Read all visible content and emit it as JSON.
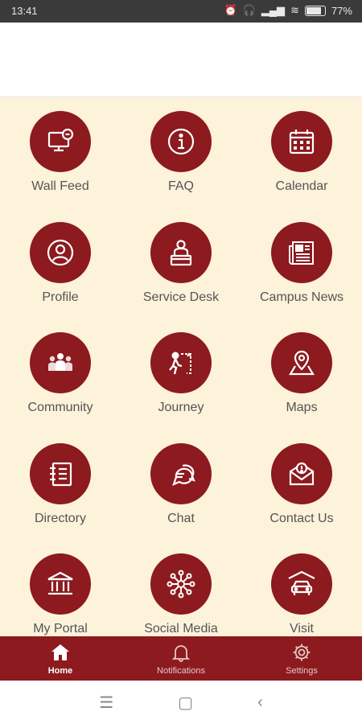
{
  "status": {
    "time": "13:41",
    "battery": "77%"
  },
  "tiles": [
    {
      "label": "Wall Feed",
      "icon": "monitor-chat-icon"
    },
    {
      "label": "FAQ",
      "icon": "info-icon"
    },
    {
      "label": "Calendar",
      "icon": "calendar-icon"
    },
    {
      "label": "Profile",
      "icon": "user-icon"
    },
    {
      "label": "Service Desk",
      "icon": "service-desk-icon"
    },
    {
      "label": "Campus News",
      "icon": "newspaper-icon"
    },
    {
      "label": "Community",
      "icon": "community-icon"
    },
    {
      "label": "Journey",
      "icon": "journey-icon"
    },
    {
      "label": "Maps",
      "icon": "map-pin-icon"
    },
    {
      "label": "Directory",
      "icon": "directory-icon"
    },
    {
      "label": "Chat",
      "icon": "chat-icon"
    },
    {
      "label": "Contact Us",
      "icon": "mail-icon"
    },
    {
      "label": "My Portal",
      "icon": "portal-building-icon"
    },
    {
      "label": "Social Media",
      "icon": "network-icon"
    },
    {
      "label": "Visit",
      "icon": "car-garage-icon"
    }
  ],
  "bottom_nav": [
    {
      "label": "Home",
      "icon": "home-icon",
      "active": true
    },
    {
      "label": "Notifications",
      "icon": "bell-icon",
      "active": false
    },
    {
      "label": "Settings",
      "icon": "gear-icon",
      "active": false
    }
  ],
  "colors": {
    "accent": "#8c1a1e",
    "background": "#fdf2da",
    "label": "#555555"
  }
}
